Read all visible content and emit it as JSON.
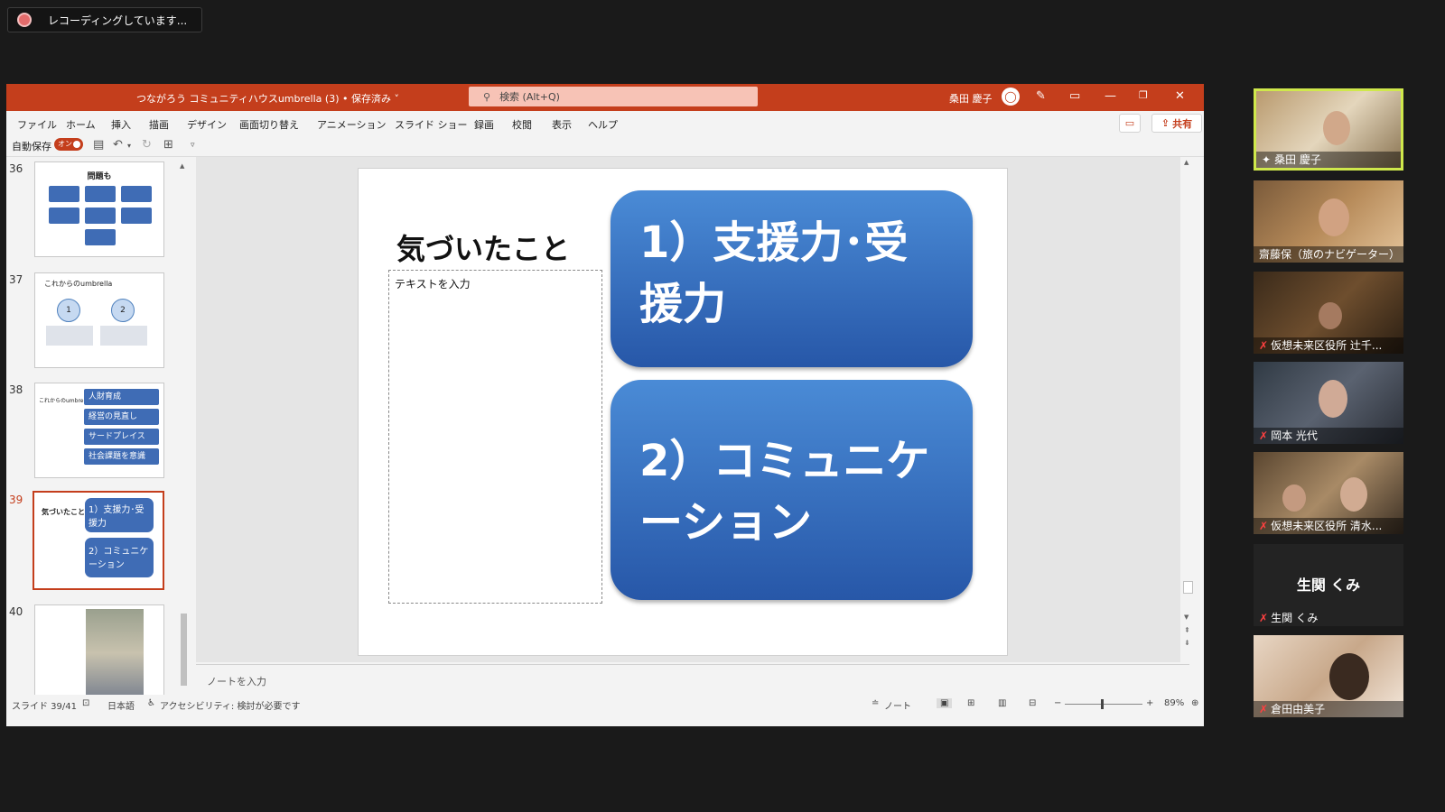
{
  "recording": {
    "text": "レコーディングしています..."
  },
  "titlebar": {
    "doc_title": "つながろう コミュニティハウスumbrella (3) • 保存済み ˅",
    "search_placeholder": "検索 (Alt+Q)",
    "user": "桑田 慶子"
  },
  "menu": {
    "items": [
      "ファイル",
      "ホーム",
      "挿入",
      "描画",
      "デザイン",
      "画面切り替え",
      "アニメーション",
      "スライド ショー",
      "録画",
      "校閲",
      "表示",
      "ヘルプ"
    ],
    "share": "共有"
  },
  "qat": {
    "autosave": "自動保存",
    "toggle": "オン"
  },
  "thumbnails": {
    "n36": "36",
    "t36_title": "問題も",
    "n37": "37",
    "t37_title": "これからのumbrella",
    "t37_c1": "1",
    "t37_c2": "2",
    "n38": "38",
    "t38_title": "これからのumbrella",
    "t38_items": [
      "人財育成",
      "経営の見直し",
      "サードプレイス",
      "社会課題を意識"
    ],
    "n39": "39",
    "t39_title": "気づいたこと",
    "t39_b1": "1）支援力･受援力",
    "t39_b2": "2）コミュニケーション",
    "n40": "40"
  },
  "slide": {
    "title": "気づいたこと",
    "placeholder": "テキストを入力",
    "box1": "1）支援力･受援力",
    "box2": "2）コミュニケーション"
  },
  "notes": {
    "placeholder": "ノートを入力"
  },
  "status": {
    "slide_pos": "スライド 39/41",
    "language": "日本語",
    "accessibility": "アクセシビリティ: 検討が必要です",
    "notes_btn": "ノート",
    "zoom": "89%"
  },
  "participants": [
    {
      "name": "桑田 慶子"
    },
    {
      "name": "齋藤保（旅のナビゲーター）"
    },
    {
      "name": "仮想未来区役所 辻千..."
    },
    {
      "name": "岡本 光代"
    },
    {
      "name": "仮想未来区役所 清水..."
    },
    {
      "name": "生関 くみ",
      "display": "生関 くみ"
    },
    {
      "name": "倉田由美子"
    }
  ]
}
